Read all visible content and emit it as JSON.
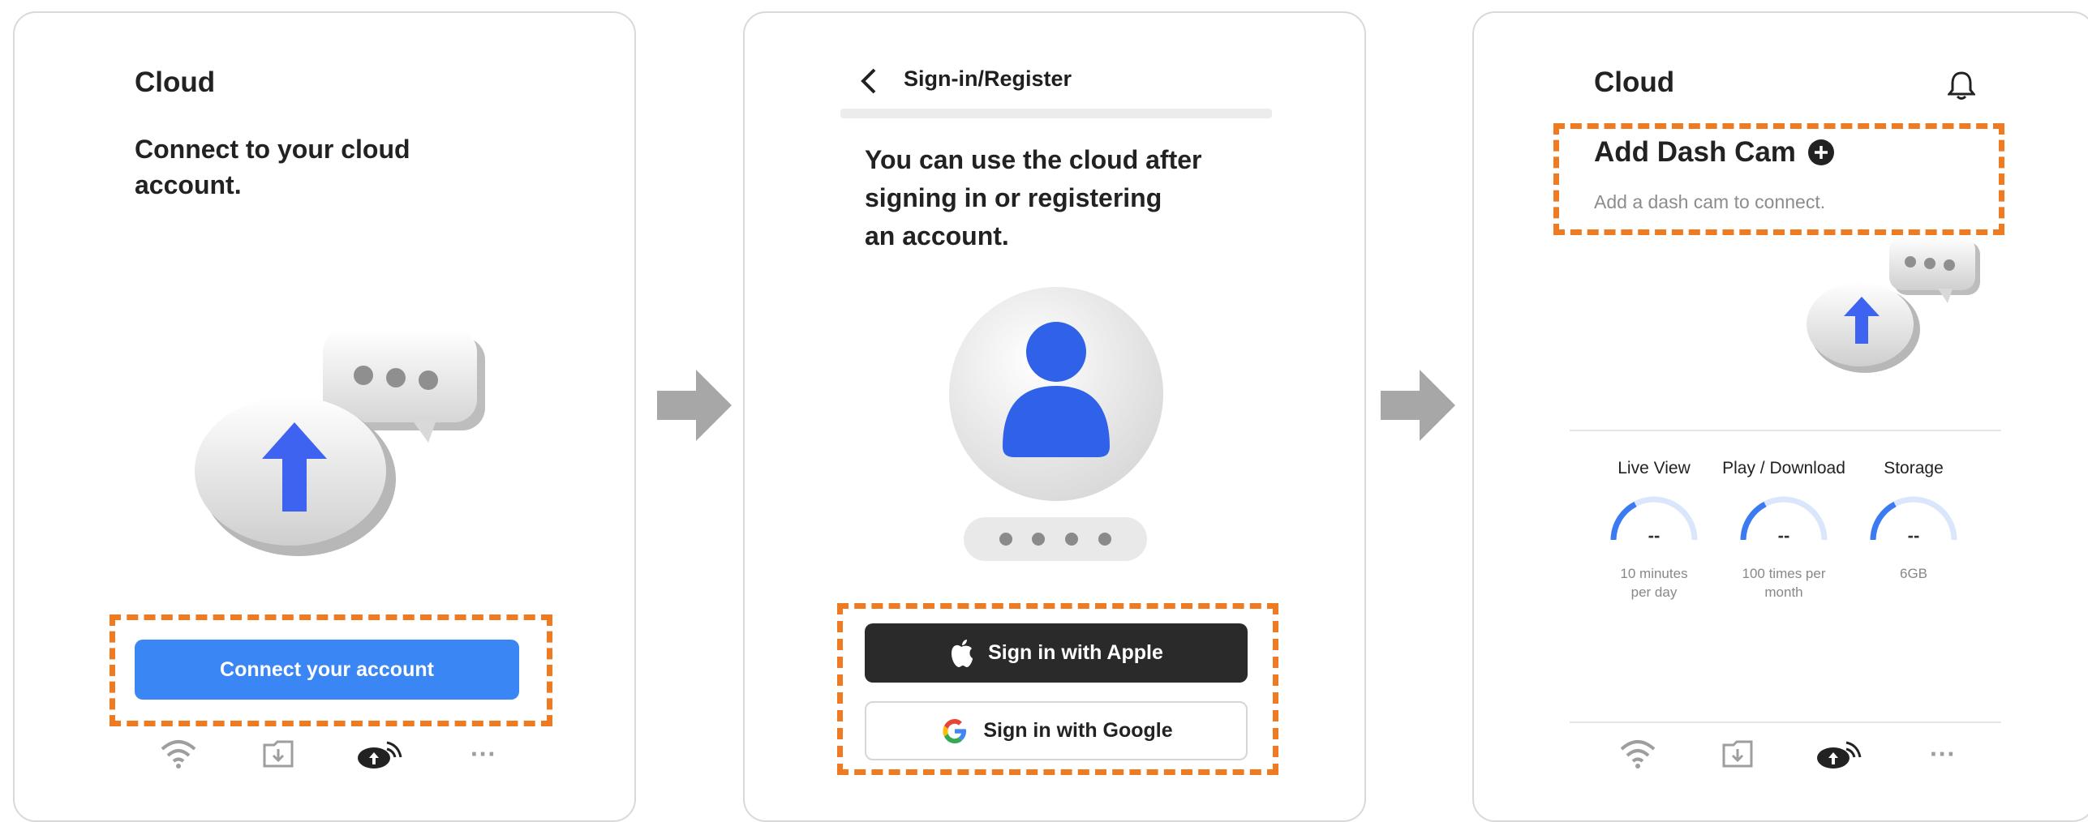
{
  "screen1": {
    "title": "Cloud",
    "headline_line1": "Connect to your cloud",
    "headline_line2": "account.",
    "connect_button": "Connect your account",
    "tab_more": "···"
  },
  "screen2": {
    "header_title": "Sign-in/Register",
    "headline_line1": "You can use the cloud after",
    "headline_line2": "signing in or registering",
    "headline_line3": "an account.",
    "apple_button": "Sign in with Apple",
    "google_button": "Sign in with Google"
  },
  "screen3": {
    "title": "Cloud",
    "add_title": "Add Dash Cam",
    "add_subtitle": "Add a dash cam to connect.",
    "gauges": [
      {
        "label": "Live View",
        "value": "--",
        "sub1": "10 minutes",
        "sub2": "per day"
      },
      {
        "label": "Play / Download",
        "value": "--",
        "sub1": "100 times per",
        "sub2": "month"
      },
      {
        "label": "Storage",
        "value": "--",
        "sub1": "6GB",
        "sub2": ""
      }
    ],
    "tab_more": "···"
  },
  "colors": {
    "accent": "#3a86f5",
    "highlight": "#ee7a22",
    "dark": "#2a2a2a",
    "arrow": "#a7a7a7"
  },
  "icons": [
    "wifi-icon",
    "download-folder-icon",
    "cloud-upload-icon",
    "more-icon",
    "bell-icon",
    "back-icon",
    "apple-icon",
    "google-icon",
    "plus-circle-icon"
  ]
}
